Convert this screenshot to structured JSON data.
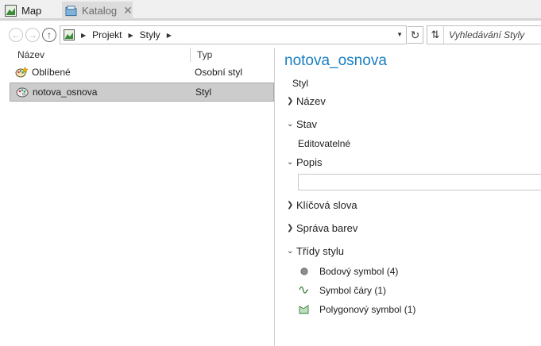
{
  "tabs": [
    {
      "label": "Map",
      "icon": "map-icon"
    },
    {
      "label": "Katalog",
      "icon": "catalog-icon",
      "close": "✕"
    }
  ],
  "breadcrumb": [
    "Projekt",
    "Styly"
  ],
  "search": {
    "placeholder": "Vyhledávání Styly"
  },
  "list": {
    "columns": {
      "name": "Název",
      "type": "Typ"
    },
    "rows": [
      {
        "name": "Oblíbené",
        "type": "Osobní styl",
        "icon": "favorite-style-icon"
      },
      {
        "name": "notova_osnova",
        "type": "Styl",
        "icon": "style-icon",
        "selected": true
      }
    ]
  },
  "details": {
    "title": "notova_osnova",
    "subtype": "Styl",
    "sections": {
      "nazev": "Název",
      "stav": "Stav",
      "stav_value": "Editovatelné",
      "popis": "Popis",
      "klicova_slova": "Klíčová slova",
      "sprava_barev": "Správa barev",
      "tridy_stylu": "Třídy stylu"
    },
    "classes": [
      {
        "label": "Bodový symbol (4)",
        "icon": "point-symbol-icon"
      },
      {
        "label": "Symbol čáry (1)",
        "icon": "line-symbol-icon"
      },
      {
        "label": "Polygonový symbol (1)",
        "icon": "polygon-symbol-icon"
      }
    ]
  },
  "colors": {
    "accent": "#1a7ec2",
    "selection": "#cccccc"
  }
}
